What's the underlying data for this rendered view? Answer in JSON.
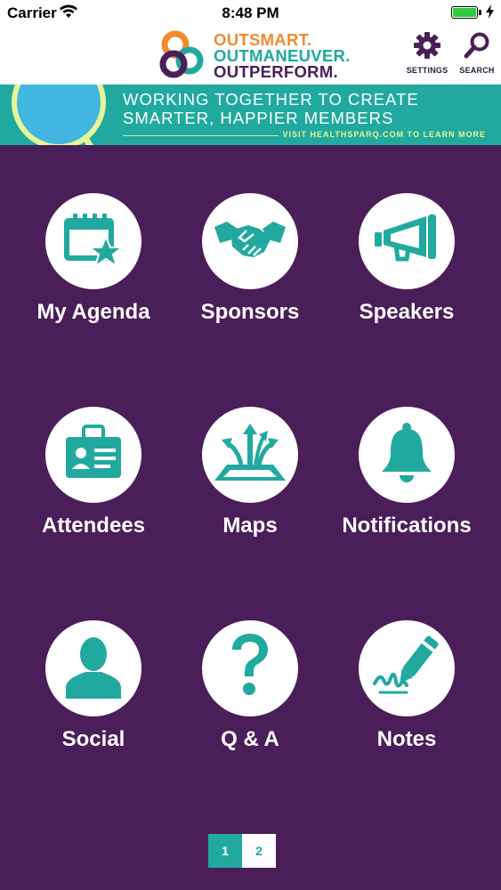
{
  "status_bar": {
    "carrier": "Carrier",
    "time": "8:48 PM"
  },
  "header": {
    "logo_line1": "OUTSMART.",
    "logo_line2": "OUTMANEUVER.",
    "logo_line3": "OUTPERFORM.",
    "settings_label": "SETTINGS",
    "search_label": "SEARCH",
    "settings_icon": "gear-icon",
    "search_icon": "magnifier-icon"
  },
  "banner": {
    "line1": "WORKING TOGETHER TO CREATE",
    "line2": "SMARTER, HAPPIER MEMBERS",
    "cta": "VISIT HEALTHSPARQ.COM TO LEARN MORE"
  },
  "menu": [
    {
      "label": "My Agenda",
      "icon": "calendar-star-icon"
    },
    {
      "label": "Sponsors",
      "icon": "handshake-icon"
    },
    {
      "label": "Speakers",
      "icon": "megaphone-icon"
    },
    {
      "label": "Attendees",
      "icon": "id-badge-icon"
    },
    {
      "label": "Maps",
      "icon": "map-arrows-icon"
    },
    {
      "label": "Notifications",
      "icon": "bell-icon"
    },
    {
      "label": "Social",
      "icon": "person-silhouette-icon"
    },
    {
      "label": "Q & A",
      "icon": "question-mark-icon"
    },
    {
      "label": "Notes",
      "icon": "pen-signature-icon"
    }
  ],
  "pager": {
    "pages": [
      "1",
      "2"
    ],
    "current": "1"
  },
  "colors": {
    "background": "#4a1e58",
    "teal": "#21a99f",
    "orange": "#f28a2e",
    "white": "#ffffff"
  }
}
